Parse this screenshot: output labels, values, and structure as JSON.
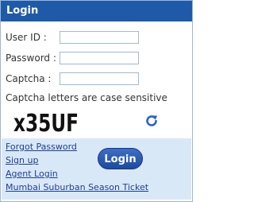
{
  "header": {
    "title": "Login"
  },
  "form": {
    "user_id_label": "User ID :",
    "password_label": "Password :",
    "captcha_label": "Captcha :",
    "user_id_value": "",
    "password_value": "",
    "captcha_value": "",
    "case_hint": "Captcha letters are case sensitive",
    "captcha_text": "x35UF"
  },
  "links": {
    "forgot_password": "Forgot Password",
    "sign_up": "Sign up",
    "agent_login": "Agent Login",
    "season_ticket": "Mumbai Suburban Season Ticket"
  },
  "login_button": "Login",
  "colors": {
    "header": "#1e5aa8",
    "bottom_panel": "#d9e8f7",
    "link": "#1f3f8f",
    "refresh_icon": "#2a62c9"
  },
  "icons": {
    "refresh": "refresh-icon"
  }
}
